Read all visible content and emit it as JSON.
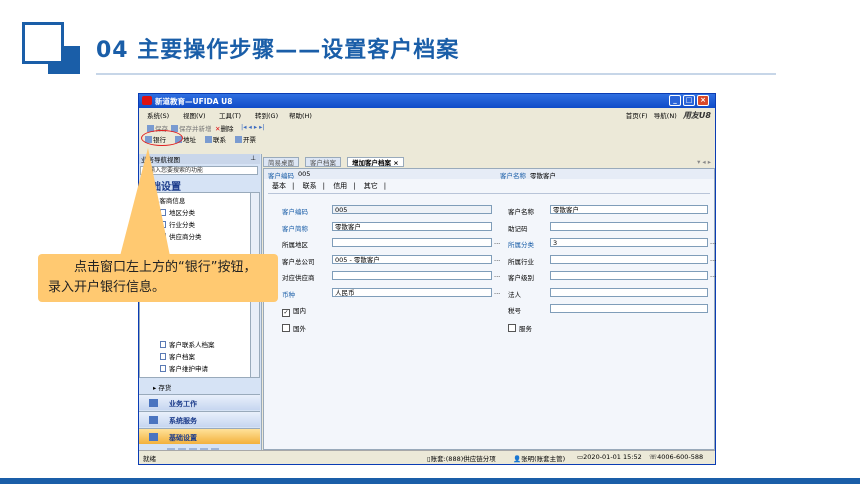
{
  "slide": {
    "title": "04  主要操作步骤——设置客户档案",
    "callout": "　　点击窗口左上方的“银行”按钮，录入开户银行信息。"
  },
  "window": {
    "title": "新道教育—UFIDA U8",
    "menu": [
      "系统(S)",
      "视图(V)",
      "工具(T)",
      "转到(G)",
      "帮助(H)"
    ],
    "top_links": [
      "首页(F)",
      "导航(N)"
    ],
    "brand": "用友U8",
    "toolbar1": [
      "保存",
      "保存并新增",
      "删除"
    ],
    "toolbar2": [
      "银行",
      "地址",
      "联系",
      "开票"
    ]
  },
  "nav": {
    "header": "业务导航视图",
    "search_placeholder": "请输入您要搜索的功能",
    "section": "基础设置",
    "tree_group": "客商信息",
    "tree_items": [
      "地区分类",
      "行业分类",
      "供应商分类",
      "客户联系人档案",
      "客户档案",
      "客户维护申请"
    ],
    "tree_next": "存货",
    "categories": [
      "业务工作",
      "系统服务",
      "基础设置"
    ]
  },
  "tabs": [
    "简易桌面",
    "客户档案",
    "增加客户档案"
  ],
  "form": {
    "header_code_label": "客户编码",
    "header_code_value": "005",
    "header_name_label": "客户名称",
    "header_name_value": "零散客户",
    "inner_tabs": [
      "基本",
      "联系",
      "信用",
      "其它"
    ],
    "left": [
      {
        "label": "客户编码",
        "value": "005",
        "blue": true,
        "ellipsis": false,
        "readonly": true
      },
      {
        "label": "客户简称",
        "value": "零散客户",
        "blue": true,
        "ellipsis": false,
        "readonly": false
      },
      {
        "label": "所属地区",
        "value": "",
        "blue": false,
        "ellipsis": true,
        "readonly": false
      },
      {
        "label": "客户总公司",
        "value": "005 - 零散客户",
        "blue": false,
        "ellipsis": true,
        "readonly": false
      },
      {
        "label": "对应供应商",
        "value": "",
        "blue": false,
        "ellipsis": true,
        "readonly": false
      },
      {
        "label": "币种",
        "value": "人民币",
        "blue": true,
        "ellipsis": true,
        "readonly": false
      }
    ],
    "right": [
      {
        "label": "客户名称",
        "value": "零散客户",
        "blue": false,
        "ellipsis": false
      },
      {
        "label": "助记码",
        "value": "",
        "blue": false,
        "ellipsis": false
      },
      {
        "label": "所属分类",
        "value": "3",
        "blue": true,
        "ellipsis": true
      },
      {
        "label": "所属行业",
        "value": "",
        "blue": false,
        "ellipsis": true
      },
      {
        "label": "客户级别",
        "value": "",
        "blue": false,
        "ellipsis": true
      },
      {
        "label": "法人",
        "value": "",
        "blue": false,
        "ellipsis": false
      },
      {
        "label": "税号",
        "value": "",
        "blue": false,
        "ellipsis": false
      }
    ],
    "checks": [
      {
        "label": "国内",
        "checked": true
      },
      {
        "label": "国外",
        "checked": false
      },
      {
        "label": "服务",
        "checked": false
      }
    ]
  },
  "status": {
    "left": "就绪",
    "account": "账套:(888)供应链分项",
    "user": "张明(账套主管)",
    "datetime": "2020-01-01 15:52",
    "phone": "4006-600-588"
  }
}
